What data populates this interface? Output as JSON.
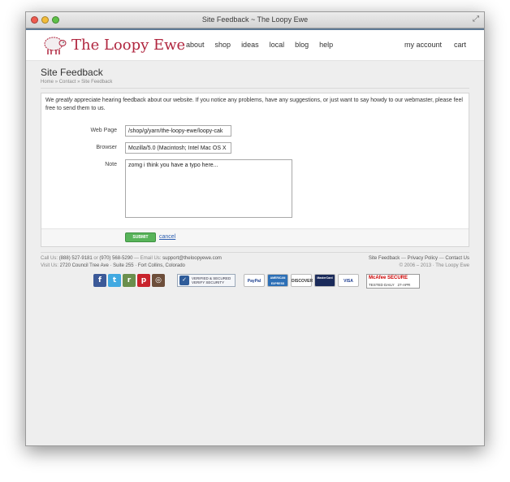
{
  "window": {
    "title": "Site Feedback ~ The Loopy Ewe"
  },
  "header": {
    "logo_text": "The Loopy Ewe",
    "nav": [
      "about",
      "shop",
      "ideas",
      "local",
      "blog",
      "help"
    ],
    "account": "my account",
    "cart": "cart"
  },
  "page": {
    "title": "Site Feedback",
    "breadcrumb": [
      "Home",
      "Contact",
      "Site Feedback"
    ],
    "intro_before": "We ",
    "intro_em": "greatly",
    "intro_after": " appreciate hearing feedback about our website. If you notice any problems, have any suggestions, or just want to say howdy to our webmaster, please feel free to send them to us."
  },
  "form": {
    "web_page_label": "Web Page",
    "web_page_value": "/shop/g/yarn/the-loopy-ewe/loopy-cak",
    "browser_label": "Browser",
    "browser_value": "Mozilla/5.0 (Macintosh; Intel Mac OS X",
    "note_label": "Note",
    "note_value": "zomg i think you have a typo here...",
    "submit_label": "SUBMIT",
    "cancel_label": "cancel"
  },
  "footer": {
    "call_label": "Call Us:",
    "phone1": "(888) 527-9181",
    "or": "or",
    "phone2": "(970) 568-5290",
    "email_label": "Email Us:",
    "email": "support@theloopyewe.com",
    "visit_label": "Visit Us:",
    "address": "2720 Council Tree Ave · Suite 255 · Fort Collins, Colorado",
    "links": [
      "Site Feedback",
      "Privacy Policy",
      "Contact Us"
    ],
    "copyright": "© 2006 – 2013 · The Loopy Ewe"
  },
  "badges": {
    "social": [
      {
        "name": "facebook",
        "glyph": "f",
        "color": "#3b5998"
      },
      {
        "name": "twitter",
        "glyph": "t",
        "color": "#41a9e1"
      },
      {
        "name": "ravelry",
        "glyph": "r",
        "color": "#6a8f4d"
      },
      {
        "name": "pinterest",
        "glyph": "p",
        "color": "#c8232c"
      },
      {
        "name": "instagram",
        "glyph": "◎",
        "color": "#6d4e3a"
      }
    ],
    "verified_line1": "VERIFIED & SECURED",
    "verified_line2": "VERIFY SECURITY",
    "cards": [
      {
        "name": "paypal",
        "text": "PayPal",
        "bg": "#ffffff",
        "fg": "#1b3f8f"
      },
      {
        "name": "amex",
        "text": "AMERICAN EXPRESS",
        "bg": "#2c6fb6",
        "fg": "#ffffff"
      },
      {
        "name": "discover",
        "text": "DISCOVER",
        "bg": "#ffffff",
        "fg": "#333333"
      },
      {
        "name": "mastercard",
        "text": "MasterCard",
        "bg": "#1a2a5a",
        "fg": "#ffffff"
      },
      {
        "name": "visa",
        "text": "VISA",
        "bg": "#ffffff",
        "fg": "#1a3a8f"
      }
    ],
    "mcafee_title": "McAfee SECURE",
    "mcafee_tested": "TESTED DAILY",
    "mcafee_date": "27-APR"
  },
  "colors": {
    "brand": "#b0263f",
    "submit": "#58b45a",
    "link": "#2a5db0",
    "titlebar_accent": "#5e7a95"
  }
}
